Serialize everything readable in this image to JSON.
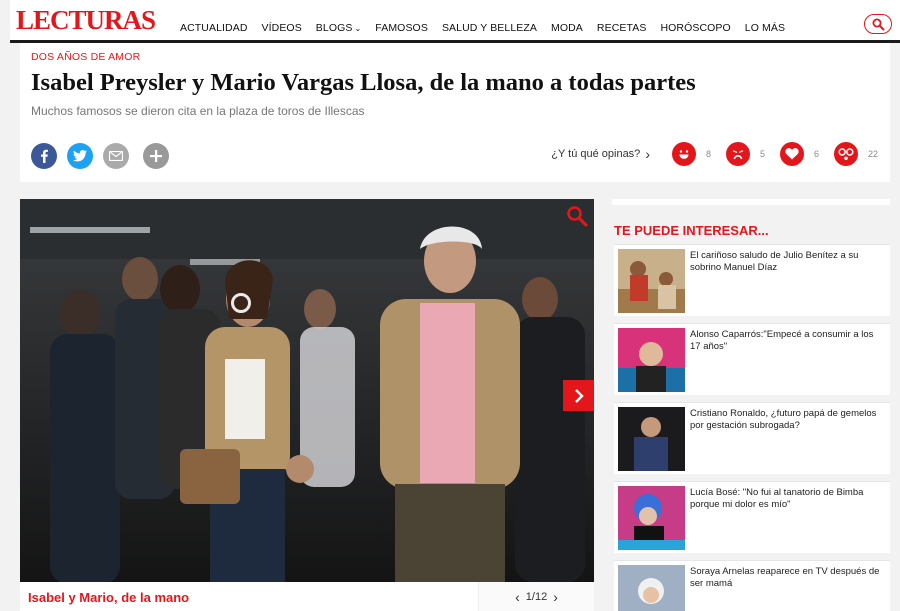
{
  "header": {
    "logo": "LECTURAS",
    "nav": [
      {
        "label": "ACTUALIDAD"
      },
      {
        "label": "VÍDEOS"
      },
      {
        "label": "BLOGS",
        "dropdown": true
      },
      {
        "label": "FAMOSOS"
      },
      {
        "label": "SALUD Y BELLEZA"
      },
      {
        "label": "MODA"
      },
      {
        "label": "RECETAS"
      },
      {
        "label": "HORÓSCOPO"
      },
      {
        "label": "LO MÁS"
      }
    ],
    "search_icon": "search-icon"
  },
  "article": {
    "kicker": "DOS AÑOS DE AMOR",
    "title": "Isabel Preysler y Mario Vargas Llosa, de la mano a todas partes",
    "subtitle": "Muchos famosos se dieron cita en la plaza de toros de Illescas",
    "share": [
      {
        "name": "facebook",
        "glyph": "f",
        "color": "#3b5998"
      },
      {
        "name": "twitter",
        "glyph": "t",
        "color": "#1da1f2"
      },
      {
        "name": "email",
        "glyph": "",
        "color": "#aaaaaa"
      },
      {
        "name": "more",
        "glyph": "+",
        "color": "#999999"
      }
    ],
    "opinion_label": "¿Y tú qué opinas?",
    "reactions": [
      {
        "icon": "laugh-face-icon",
        "count": "8"
      },
      {
        "icon": "sad-face-icon",
        "count": "5"
      },
      {
        "icon": "heart-icon",
        "count": "6"
      },
      {
        "icon": "surprised-face-icon",
        "count": "22"
      }
    ]
  },
  "gallery": {
    "caption": "Isabel y Mario, de la mano",
    "pager": "1/12",
    "accent": "#e3171b"
  },
  "sidebar": {
    "heading": "TE PUEDE INTERESAR...",
    "items": [
      {
        "title": "El cariñoso saludo de Julio Benítez a su sobrino Manuel Díaz"
      },
      {
        "title": "Alonso Caparrós:\"Empecé a consumir a los 17 años\""
      },
      {
        "title": "Cristiano Ronaldo, ¿futuro papá de gemelos por gestación subrogada?"
      },
      {
        "title": "Lucía Bosé: \"No fui al tanatorio de Bimba porque mi dolor es mío\""
      },
      {
        "title": "Soraya Arnelas reaparece en TV después de ser mamá"
      }
    ]
  }
}
